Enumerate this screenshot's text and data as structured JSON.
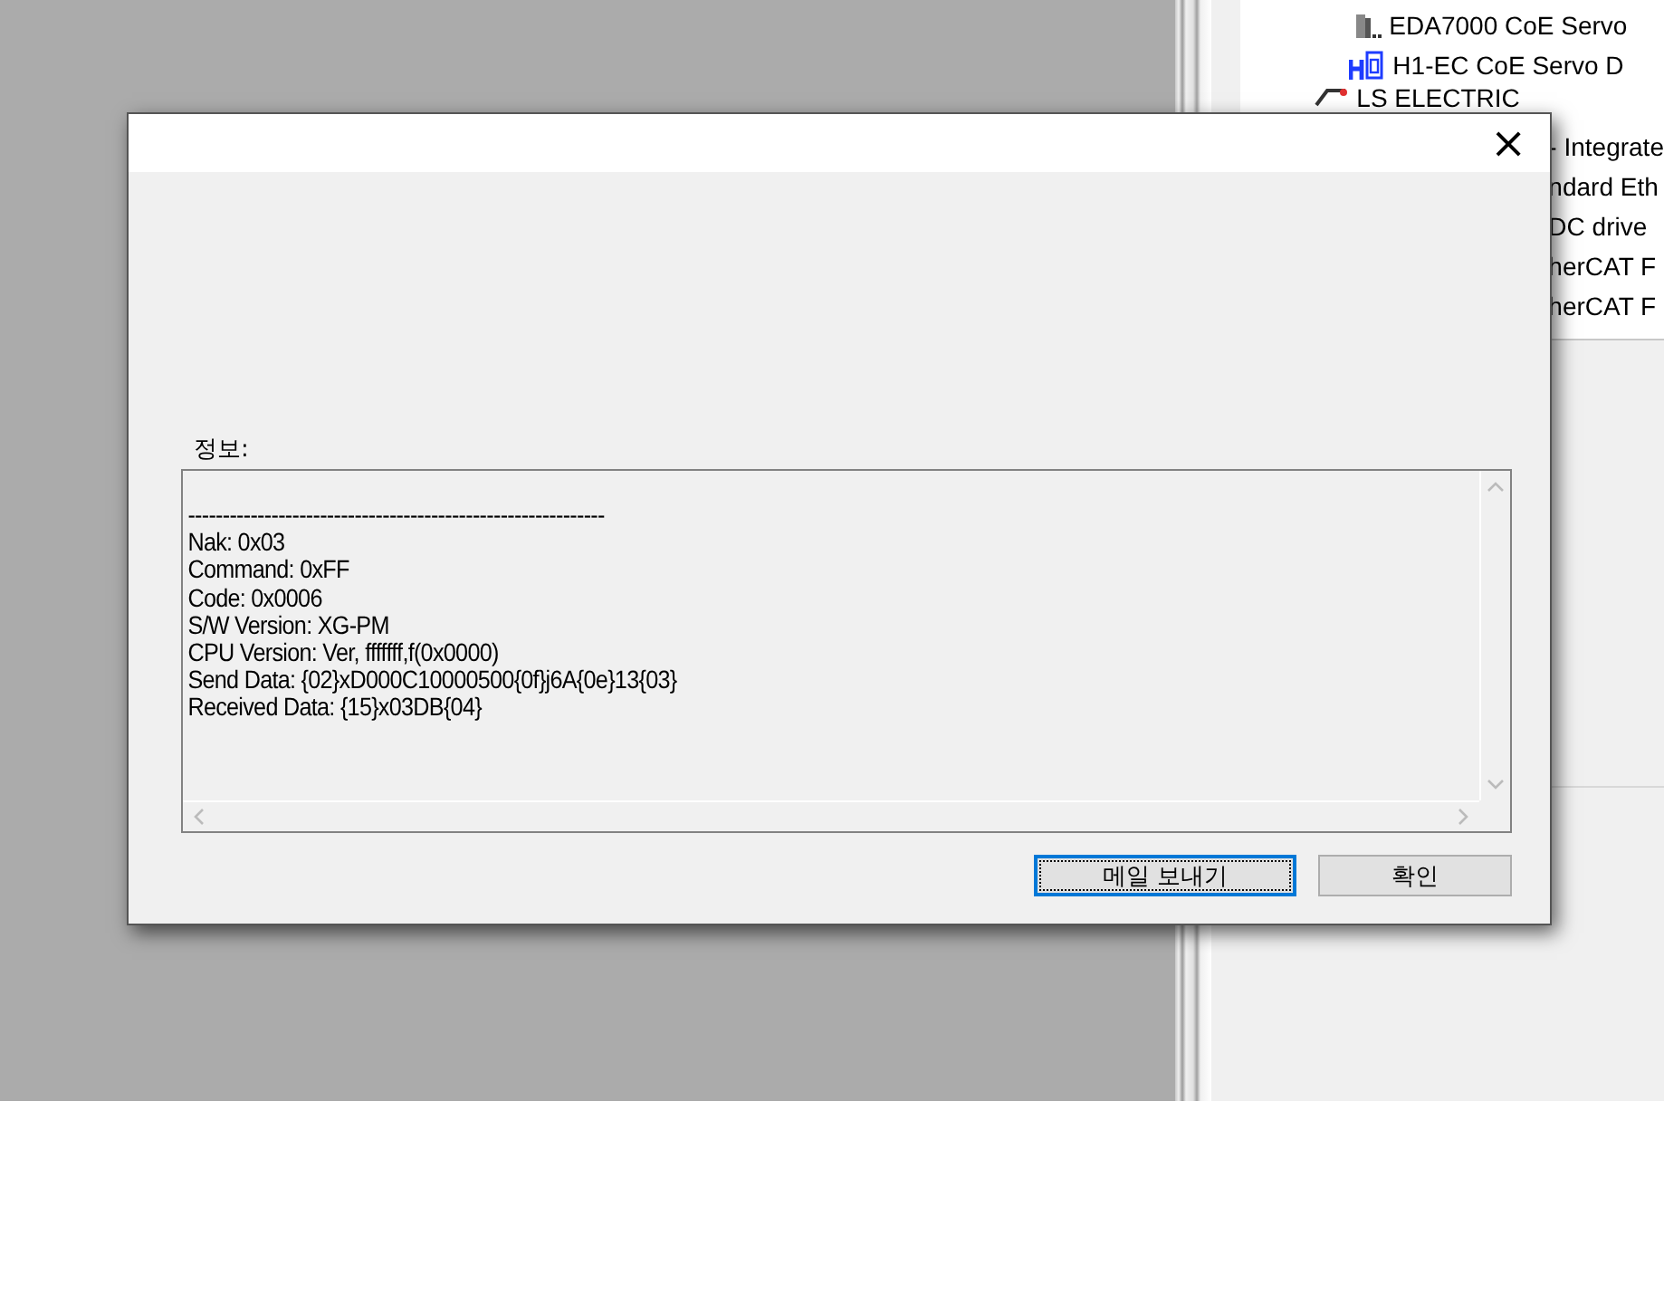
{
  "device_tree": {
    "items": [
      {
        "label": "EDA7000 CoE Servo",
        "kind": "device"
      },
      {
        "label": "H1-EC CoE Servo D",
        "kind": "device-blue"
      },
      {
        "label": "LS ELECTRIC",
        "kind": "vendor"
      },
      {
        "label": "- Integrate",
        "kind": "cut"
      },
      {
        "label": "ndard Eth",
        "kind": "cut"
      },
      {
        "label": "DC drive",
        "kind": "cut"
      },
      {
        "label": "herCAT F",
        "kind": "cut"
      },
      {
        "label": "herCAT F",
        "kind": "cut"
      }
    ]
  },
  "dialog": {
    "close": "×",
    "info_label": "정보:",
    "log_lines": [
      "------------------------------------------------------------",
      "Nak: 0x03",
      "Command: 0xFF",
      "Code: 0x0006",
      "S/W Version: XG-PM",
      "CPU Version: Ver, fffffff,f(0x0000)",
      "Send Data: {02}xD000C10000500{0f}j6A{0e}13{03}",
      "Received Data: {15}x03DB{04}"
    ],
    "buttons": [
      {
        "label": "메일 보내기",
        "focused": true
      },
      {
        "label": "확인",
        "focused": false
      }
    ]
  }
}
